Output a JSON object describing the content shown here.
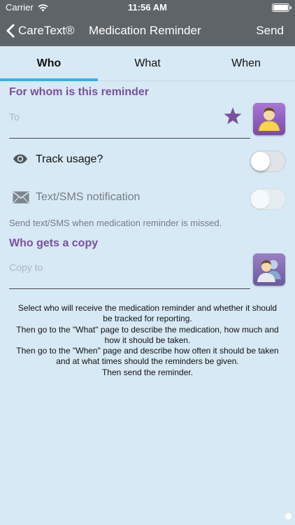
{
  "status_bar": {
    "carrier": "Carrier",
    "time": "11:56 AM",
    "wifi_icon": "wifi-icon",
    "battery_icon": "battery-icon"
  },
  "nav": {
    "back_label": "CareText®",
    "title": "Medication Reminder",
    "send_label": "Send",
    "back_icon": "chevron-left-icon"
  },
  "tabs": [
    {
      "label": "Who",
      "active": true
    },
    {
      "label": "What",
      "active": false
    },
    {
      "label": "When",
      "active": false
    }
  ],
  "who": {
    "heading": "For whom is this reminder",
    "to_placeholder": "To",
    "favorite_icon": "star-icon",
    "contact_icon": "person-icon",
    "track_usage": {
      "label": "Track usage?",
      "icon": "eye-icon",
      "on": false
    },
    "sms_notification": {
      "label": "Text/SMS notification",
      "icon": "envelope-icon",
      "on": false,
      "enabled": false
    },
    "sms_hint": "Send text/SMS when medication reminder is missed.",
    "copy_heading": "Who gets a copy",
    "copy_placeholder": "Copy to",
    "copy_contacts_icon": "people-icon"
  },
  "instructions": [
    "Select who will receive the medication reminder and whether it should be tracked for reporting.",
    "Then go to the \"What\" page to describe the medication, how much and how it should be taken.",
    "Then go to the \"When\" page and describe how often it should be taken and at what times should the reminders be given.",
    "Then send the reminder."
  ],
  "colors": {
    "nav_background": "#5f6468",
    "page_background": "#d7e9f5",
    "accent_purple": "#7a4fa0",
    "tab_indicator": "#37b2e6"
  }
}
